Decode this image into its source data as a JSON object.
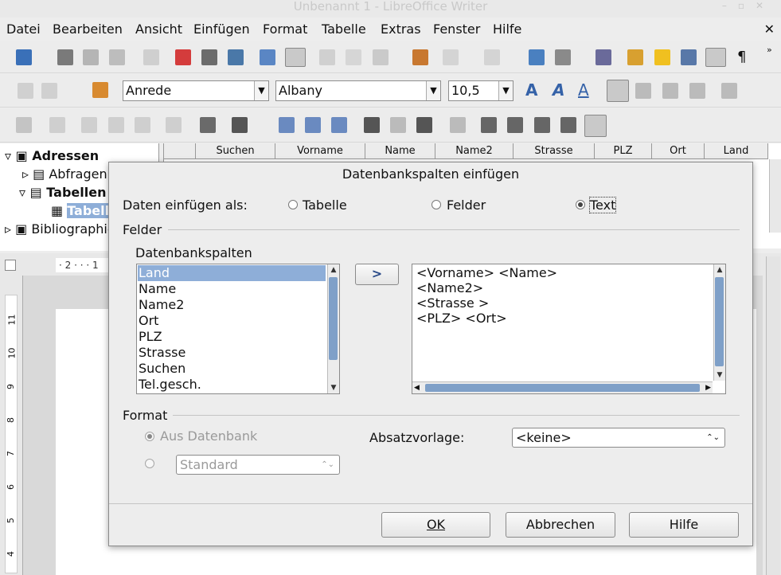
{
  "window": {
    "title": "Unbenannt 1 - LibreOffice Writer"
  },
  "menu": [
    "Datei",
    "Bearbeiten",
    "Ansicht",
    "Einfügen",
    "Format",
    "Tabelle",
    "Extras",
    "Fenster",
    "Hilfe"
  ],
  "formatting": {
    "style": "Anrede",
    "font": "Albany",
    "size": "10,5"
  },
  "navigator": {
    "items": [
      {
        "label": "Adressen",
        "bold": true
      },
      {
        "label": "Abfragen"
      },
      {
        "label": "Tabellen",
        "bold": true
      },
      {
        "label": "Tabelle"
      },
      {
        "label": "Bibliographie"
      }
    ]
  },
  "grid": {
    "columns": [
      "Suchen",
      "Vorname",
      "Name",
      "Name2",
      "Strasse",
      "PLZ",
      "Ort",
      "Land"
    ]
  },
  "ruler": {
    "top_marks": "· 2 · · · 1",
    "left_marks": [
      "11",
      "10",
      "9",
      "8",
      "7",
      "6",
      "5",
      "4"
    ]
  },
  "dialog": {
    "title": "Datenbankspalten einfügen",
    "insert_as_label": "Daten einfügen als:",
    "options": [
      "Tabelle",
      "Felder",
      "Text"
    ],
    "selected_option": "Text",
    "fields_group": "Felder",
    "db_columns_label": "Datenbankspalten",
    "columns": [
      "Land",
      "Name",
      "Name2",
      "Ort",
      "PLZ",
      "Strasse",
      "Suchen",
      "Tel.gesch."
    ],
    "selected_column": "Land",
    "transfer_button": ">",
    "text_lines": [
      "<Vorname> <Name>",
      "<Name2>",
      "<Strasse >",
      "<PLZ> <Ort>"
    ],
    "format_group": "Format",
    "from_db_label": "Aus Datenbank",
    "standard_value": "Standard",
    "para_style_label": "Absatzvorlage:",
    "para_style_value": "<keine>",
    "buttons": {
      "ok": "OK",
      "cancel": "Abbrechen",
      "help": "Hilfe"
    }
  }
}
